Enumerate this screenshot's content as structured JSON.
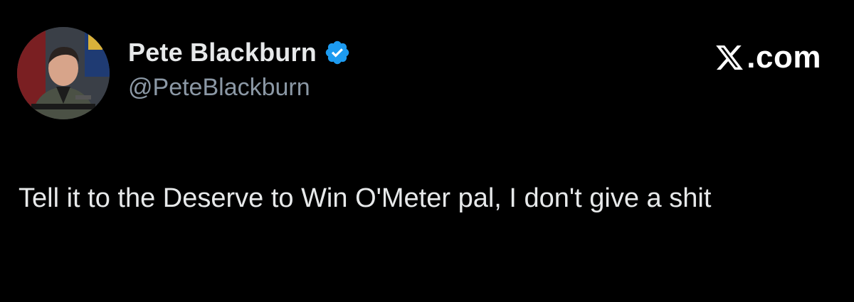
{
  "tweet": {
    "author": {
      "display_name": "Pete Blackburn",
      "handle": "@PeteBlackburn",
      "verified": true,
      "verified_icon": "verified-badge-icon",
      "avatar_icon": "avatar-photo"
    },
    "site": {
      "logo_icon": "x-logo-icon",
      "domain": ".com"
    },
    "text": "Tell it to the Deserve to Win O'Meter pal, I don't give a shit"
  },
  "colors": {
    "background": "#000000",
    "text_primary": "#e7e9ea",
    "text_secondary": "#8b98a5",
    "verified_blue": "#1d9bf0"
  }
}
